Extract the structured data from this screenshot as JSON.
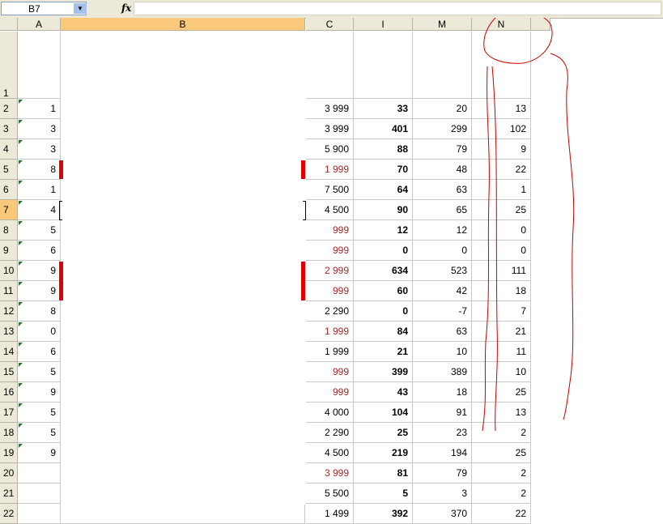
{
  "formula_bar": {
    "name_box": "B7",
    "fx_label": "fx",
    "formula": ""
  },
  "columns": [
    {
      "id": "A",
      "label": "A"
    },
    {
      "id": "B",
      "label": "B"
    },
    {
      "id": "C",
      "label": "C"
    },
    {
      "id": "I",
      "label": "I"
    },
    {
      "id": "M",
      "label": "M"
    },
    {
      "id": "N",
      "label": "N"
    }
  ],
  "rows": [
    {
      "num": "1",
      "a": "",
      "c": "",
      "i": "",
      "m": "",
      "n": "",
      "c_red": false
    },
    {
      "num": "2",
      "a": "1",
      "c": "3 999",
      "i": "33",
      "m": "20",
      "n": "13",
      "c_red": false
    },
    {
      "num": "3",
      "a": "3",
      "c": "3 999",
      "i": "401",
      "m": "299",
      "n": "102",
      "c_red": false
    },
    {
      "num": "4",
      "a": "3",
      "c": "5 900",
      "i": "88",
      "m": "79",
      "n": "9",
      "c_red": false
    },
    {
      "num": "5",
      "a": "8",
      "c": "1 999",
      "i": "70",
      "m": "48",
      "n": "22",
      "c_red": true
    },
    {
      "num": "6",
      "a": "1",
      "c": "7 500",
      "i": "64",
      "m": "63",
      "n": "1",
      "c_red": false
    },
    {
      "num": "7",
      "a": "4",
      "c": "4 500",
      "i": "90",
      "m": "65",
      "n": "25",
      "c_red": false
    },
    {
      "num": "8",
      "a": "5",
      "c": "999",
      "i": "12",
      "m": "12",
      "n": "0",
      "c_red": true
    },
    {
      "num": "9",
      "a": "6",
      "c": "999",
      "i": "0",
      "m": "0",
      "n": "0",
      "c_red": true
    },
    {
      "num": "10",
      "a": "9",
      "c": "2 999",
      "i": "634",
      "m": "523",
      "n": "111",
      "c_red": true
    },
    {
      "num": "11",
      "a": "9",
      "c": "999",
      "i": "60",
      "m": "42",
      "n": "18",
      "c_red": true
    },
    {
      "num": "12",
      "a": "8",
      "c": "2 290",
      "i": "0",
      "m": "-7",
      "n": "7",
      "c_red": false
    },
    {
      "num": "13",
      "a": "0",
      "c": "1 999",
      "i": "84",
      "m": "63",
      "n": "21",
      "c_red": true
    },
    {
      "num": "14",
      "a": "6",
      "c": "1 999",
      "i": "21",
      "m": "10",
      "n": "11",
      "c_red": false
    },
    {
      "num": "15",
      "a": "5",
      "c": "999",
      "i": "399",
      "m": "389",
      "n": "10",
      "c_red": true
    },
    {
      "num": "16",
      "a": "9",
      "c": "999",
      "i": "43",
      "m": "18",
      "n": "25",
      "c_red": true
    },
    {
      "num": "17",
      "a": "5",
      "c": "4 000",
      "i": "104",
      "m": "91",
      "n": "13",
      "c_red": false
    },
    {
      "num": "18",
      "a": "5",
      "c": "2 290",
      "i": "25",
      "m": "23",
      "n": "2",
      "c_red": false
    },
    {
      "num": "19",
      "a": "9",
      "c": "4 500",
      "i": "219",
      "m": "194",
      "n": "25",
      "c_red": false
    },
    {
      "num": "20",
      "a": "",
      "c": "3 999",
      "i": "81",
      "m": "79",
      "n": "2",
      "c_red": true
    },
    {
      "num": "21",
      "a": "",
      "c": "5 500",
      "i": "5",
      "m": "3",
      "n": "2",
      "c_red": false
    },
    {
      "num": "22",
      "a": "",
      "c": "1 499",
      "i": "392",
      "m": "370",
      "n": "22",
      "c_red": false
    }
  ],
  "selection": {
    "row": "7",
    "column": "B"
  },
  "colors": {
    "header_bg": "#ece9d8",
    "selected_header": "#f9c87a",
    "red_text": "#a52a2a",
    "marker_red": "#e00000",
    "annotation_red": "#cc0000"
  }
}
